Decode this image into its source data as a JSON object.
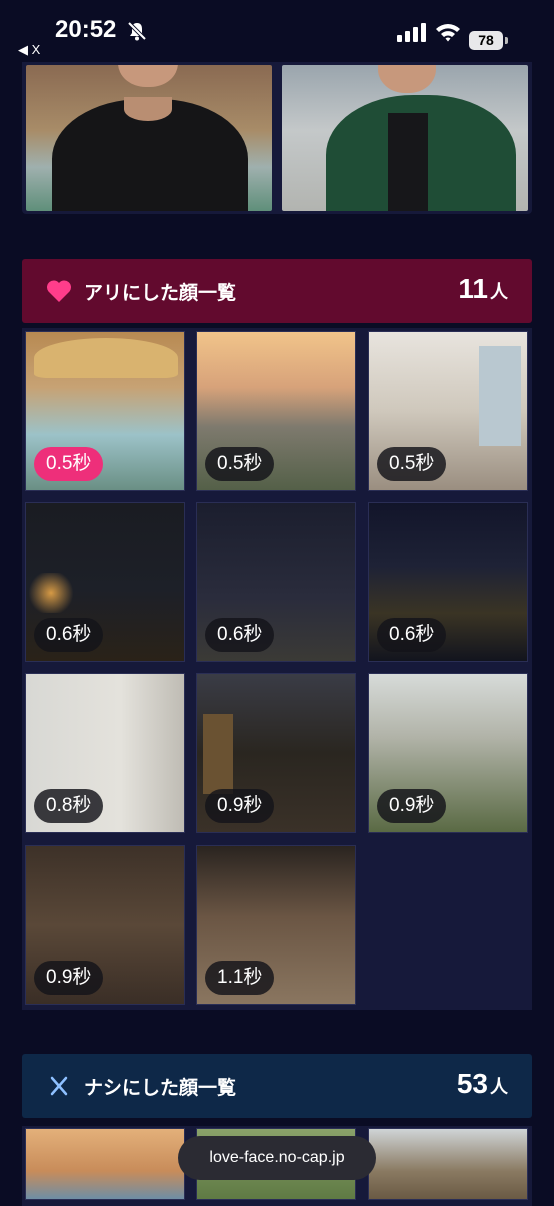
{
  "status_bar": {
    "time": "20:52",
    "back_label": "◀ X",
    "battery": "78"
  },
  "liked_section": {
    "title": "アリにした顔一覧",
    "count": "11",
    "unit": "人",
    "accent": "#620a2e",
    "icon": "heart-icon"
  },
  "liked_faces": [
    {
      "time": "0.5秒",
      "highlight": true
    },
    {
      "time": "0.5秒"
    },
    {
      "time": "0.5秒"
    },
    {
      "time": "0.6秒"
    },
    {
      "time": "0.6秒"
    },
    {
      "time": "0.6秒"
    },
    {
      "time": "0.8秒"
    },
    {
      "time": "0.9秒"
    },
    {
      "time": "0.9秒"
    },
    {
      "time": "0.9秒"
    },
    {
      "time": "1.1秒"
    }
  ],
  "rejected_section": {
    "title": "ナシにした顔一覧",
    "count": "53",
    "unit": "人",
    "accent": "#0e2848",
    "icon": "close-icon"
  },
  "toast": {
    "text": "love-face.no-cap.jp"
  }
}
